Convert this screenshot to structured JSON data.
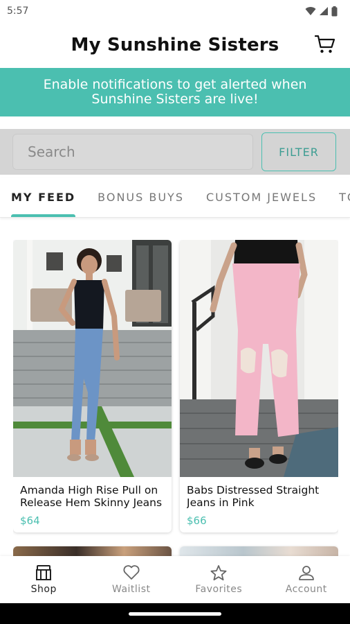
{
  "status_bar": {
    "time": "5:57",
    "icons": [
      "wifi-icon",
      "signal-icon",
      "battery-icon"
    ]
  },
  "header": {
    "title": "My Sunshine Sisters",
    "cart_icon": "cart-icon"
  },
  "notification_banner": {
    "text": "Enable notifications to get alerted when Sunshine Sisters are live!"
  },
  "search": {
    "placeholder": "Search",
    "filter_label": "FILTER"
  },
  "tabs": [
    {
      "label": "MY FEED",
      "active": true
    },
    {
      "label": "BONUS BUYS",
      "active": false
    },
    {
      "label": "CUSTOM JEWELS",
      "active": false
    },
    {
      "label": "TO",
      "active": false
    }
  ],
  "products": [
    {
      "name": "Amanda High Rise Pull on Release Hem Skinny Jeans",
      "price": "$64"
    },
    {
      "name": "Babs Distressed Straight Jeans in Pink",
      "price": "$66"
    }
  ],
  "bottom_nav": [
    {
      "label": "Shop",
      "icon": "shop-icon",
      "active": true
    },
    {
      "label": "Waitlist",
      "icon": "heart-icon",
      "active": false
    },
    {
      "label": "Favorites",
      "icon": "star-icon",
      "active": false
    },
    {
      "label": "Account",
      "icon": "person-icon",
      "active": false
    }
  ],
  "colors": {
    "accent": "#4bbfb0",
    "search_bg": "#d4d4d4"
  }
}
